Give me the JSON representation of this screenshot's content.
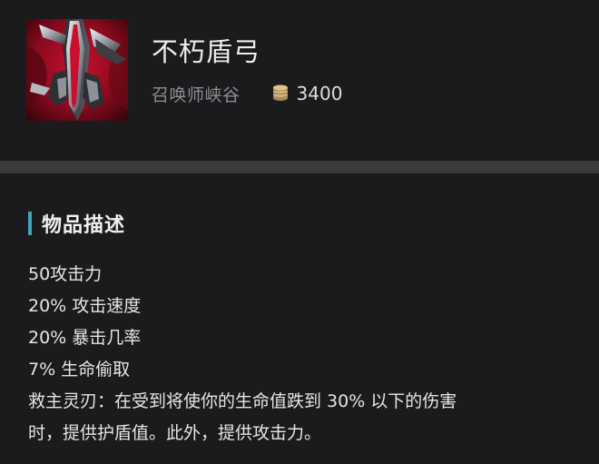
{
  "item": {
    "name": "不朽盾弓",
    "map": "召唤师峡谷",
    "price": "3400",
    "icon": "immortal-shieldbow-item-icon",
    "coin_icon": "gold-coin-icon"
  },
  "section": {
    "title": "物品描述",
    "accent_color": "#3fa7b8"
  },
  "description": {
    "lines": [
      "50攻击力",
      "20% 攻击速度",
      "20% 暴击几率",
      "7% 生命偷取",
      "救主灵刃：在受到将使你的生命值跌到 30% 以下的伤害",
      "时，提供护盾值。此外，提供攻击力。"
    ]
  }
}
